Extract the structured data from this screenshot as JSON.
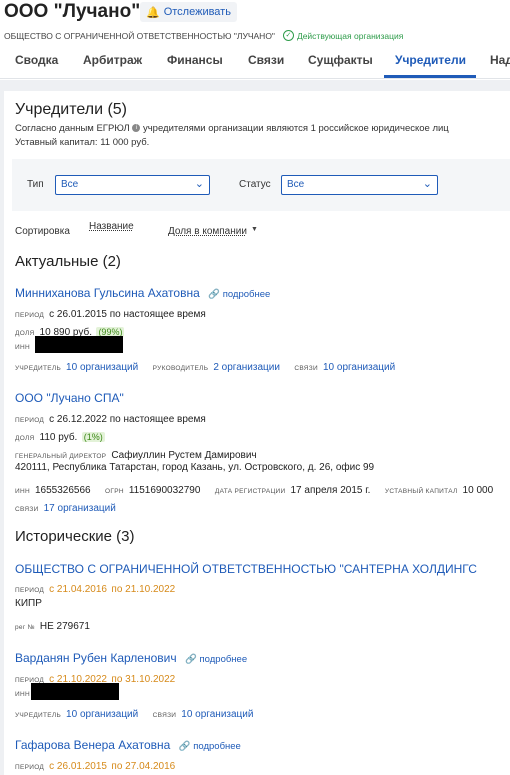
{
  "company": {
    "title": "ООО \"Лучано\"",
    "track_label": "Отслеживать",
    "full_name": "ОБЩЕСТВО С ОГРАНИЧЕННОЙ ОТВЕТСТВЕННОСТЬЮ \"ЛУЧАНО\"",
    "status": "Действующая организация"
  },
  "tabs": [
    {
      "label": "Сводка"
    },
    {
      "label": "Арбитраж"
    },
    {
      "label": "Финансы"
    },
    {
      "label": "Связи"
    },
    {
      "label": "Сущфакты"
    },
    {
      "label": "Учредители"
    },
    {
      "label": "Над"
    }
  ],
  "founders": {
    "heading": "Учредители (5)",
    "egrul_text_pre": "Согласно данным ЕГРЮЛ",
    "egrul_text_post": "учредителями организации являются 1 российское юридическое лиц",
    "capital": "Уставный капитал: 11 000 руб.",
    "filters": {
      "type_label": "Тип",
      "type_value": "Все",
      "status_label": "Статус",
      "status_value": "Все"
    },
    "sort": {
      "label": "Сортировка",
      "option1": "Название",
      "option2": "Доля в компании"
    }
  },
  "labels": {
    "period": "период",
    "share": "доля",
    "inn": "инн",
    "founder": "учредитель",
    "head": "руководитель",
    "links": "связи",
    "director": "генеральный директор",
    "ogrn": "огрн",
    "reg_date": "дата регистрации",
    "capital": "уставный капитал",
    "reg_no": "рег №",
    "more": "подробнее"
  },
  "actual": {
    "heading": "Актуальные (2)",
    "p1": {
      "name": "Минниханова Гульсина Ахатовна",
      "period": "с 26.01.2015 по настоящее время",
      "share": "10 890 руб.",
      "share_pct": "(99%)",
      "founder_count": "10 организаций",
      "head_count": "2 организации",
      "links_count": "10 организаций"
    },
    "p2": {
      "name": "ООО \"Лучано СПА\"",
      "period": "с 26.12.2022 по настоящее время",
      "share": "110 руб.",
      "share_pct": "(1%)",
      "director": "Сафиуллин Рустем Дамирович",
      "address": "420111, Республика Татарстан, город Казань, ул. Островского, д. 26, офис 99",
      "inn": "1655326566",
      "ogrn": "1151690032790",
      "reg_date": "17 апреля 2015 г.",
      "capital": "10 000",
      "links_count": "17 организаций"
    }
  },
  "historical": {
    "heading": "Исторические (3)",
    "h1": {
      "name": "ОБЩЕСТВО С ОГРАНИЧЕННОЙ ОТВЕТСТВЕННОСТЬЮ \"САНТЕРНА ХОЛДИНГС",
      "period_from": "с 21.04.2016",
      "period_to": "по 21.10.2022",
      "country": "КИПР",
      "reg_no": "НЕ 279671"
    },
    "h2": {
      "name": "Варданян Рубен Карленович",
      "period_from": "с 21.10.2022",
      "period_to": "по 31.10.2022",
      "founder_count": "10 организаций",
      "links_count": "10 организаций"
    },
    "h3": {
      "name": "Гафарова Венера Ахатовна",
      "period_from": "с 26.01.2015",
      "period_to": "по 27.04.2016"
    }
  },
  "colors": {
    "accent": "#1f5bb8",
    "success": "#2e9c4a",
    "historic_period": "#d68a1a",
    "share_highlight": "#e3f2d8"
  }
}
